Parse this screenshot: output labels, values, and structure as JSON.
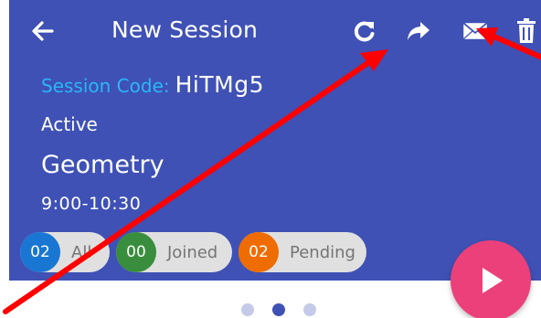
{
  "app_bar": {
    "title": "New Session",
    "icons": [
      "back-arrow-icon",
      "refresh-icon",
      "share-icon",
      "mail-icon",
      "trash-icon"
    ]
  },
  "session": {
    "code_label": "Session Code:",
    "code_value": "HiTMg5",
    "status": "Active",
    "subject": "Geometry",
    "time": "9:00-10:30"
  },
  "filters": [
    {
      "count": "02",
      "label": "All",
      "color": "#1976d2"
    },
    {
      "count": "00",
      "label": "Joined",
      "color": "#388e3c"
    },
    {
      "count": "02",
      "label": "Pending",
      "color": "#ef6c00"
    }
  ],
  "pager": {
    "active_index": 1,
    "total": 3,
    "active_color": "#3f51b5",
    "inactive_color": "#c5cae9"
  },
  "colors": {
    "header": "#3f51b5",
    "code_label": "#29b6f6",
    "fab": "#ec407a",
    "annotation": "#ff0000"
  },
  "fab": {
    "icon": "play-icon"
  }
}
